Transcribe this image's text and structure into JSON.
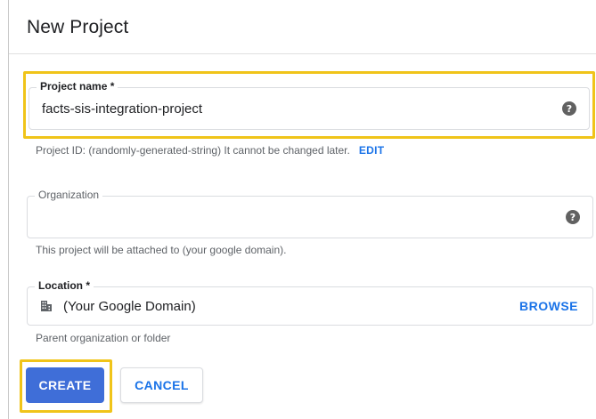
{
  "dialog": {
    "title": "New Project"
  },
  "project_name": {
    "label": "Project name *",
    "value": "facts-sis-integration-project",
    "help_icon": "help-circle-icon"
  },
  "project_id": {
    "text": "Project ID: (randomly-generated-string) It cannot be changed later.",
    "edit_label": "EDIT"
  },
  "organization": {
    "label": "Organization",
    "value": "",
    "help_icon": "help-circle-icon",
    "helper": "This project will be attached to (your google domain)."
  },
  "location": {
    "label": "Location *",
    "value": "(Your Google Domain)",
    "icon": "building-icon",
    "browse_label": "BROWSE",
    "helper": "Parent organization or folder"
  },
  "actions": {
    "create_label": "CREATE",
    "cancel_label": "CANCEL"
  },
  "colors": {
    "accent": "#1a73e8",
    "primary_button": "#3f6ed8",
    "highlight": "#f0c419"
  }
}
